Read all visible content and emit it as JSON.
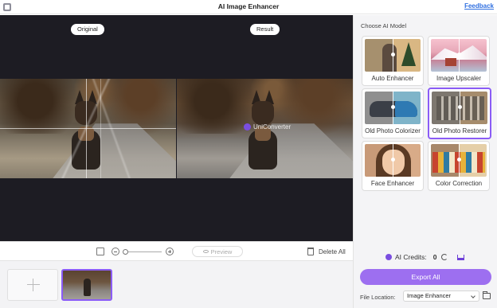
{
  "window": {
    "title": "AI Image Enhancer",
    "feedback_link": "Feedback"
  },
  "preview": {
    "original_label": "Original",
    "result_label": "Result",
    "watermark_text": "UniConverter"
  },
  "toolbar": {
    "preview_label": "Preview",
    "delete_all_label": "Delete All"
  },
  "panel": {
    "heading": "Choose AI Model",
    "models": [
      {
        "label": "Auto Enhancer",
        "selected": false
      },
      {
        "label": "Image Upscaler",
        "selected": false
      },
      {
        "label": "Old Photo Colorizer",
        "selected": false
      },
      {
        "label": "Old Photo Restorer",
        "selected": true
      },
      {
        "label": "Face Enhancer",
        "selected": false
      },
      {
        "label": "Color Correction",
        "selected": false
      }
    ],
    "credits_label": "AI Credits:",
    "credits_value": "0",
    "export_label": "Export All",
    "file_location_label": "File Location:",
    "file_location_value": "Image Enhancer"
  },
  "colors": {
    "accent": "#9d6ff0",
    "selected_border": "#8b5cf6",
    "preview_bg": "#1d1c23"
  }
}
